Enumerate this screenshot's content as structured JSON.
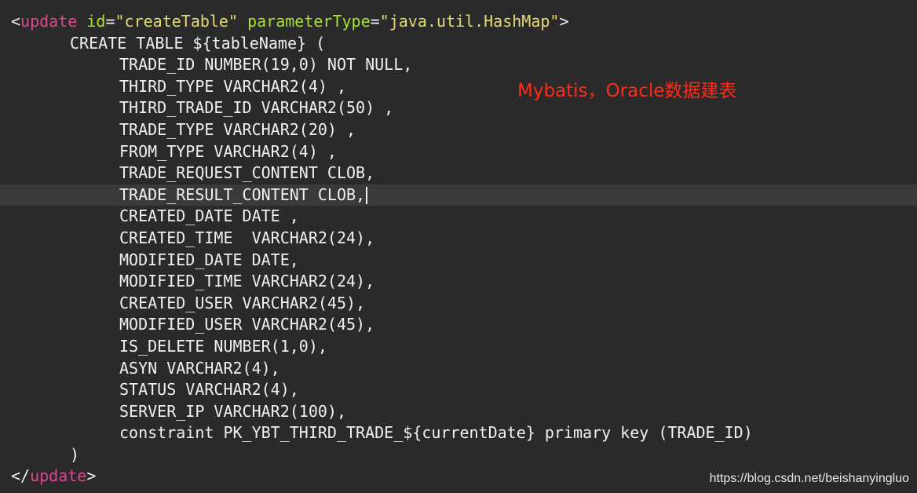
{
  "code": {
    "open_tag": {
      "lt": "<",
      "tag": "update",
      "attr1_name": "id",
      "attr1_value": "\"createTable\"",
      "attr2_name": "parameterType",
      "attr2_value": "\"java.util.HashMap\"",
      "gt": ">"
    },
    "create_line": "CREATE TABLE ${tableName} (",
    "columns": [
      "TRADE_ID NUMBER(19,0) NOT NULL,",
      "THIRD_TYPE VARCHAR2(4) ,",
      "THIRD_TRADE_ID VARCHAR2(50) ,",
      "TRADE_TYPE VARCHAR2(20) ,",
      "FROM_TYPE VARCHAR2(4) ,",
      "TRADE_REQUEST_CONTENT CLOB,",
      "TRADE_RESULT_CONTENT CLOB,",
      "CREATED_DATE DATE ,",
      "CREATED_TIME  VARCHAR2(24),",
      "MODIFIED_DATE DATE,",
      "MODIFIED_TIME VARCHAR2(24),",
      "CREATED_USER VARCHAR2(45),",
      "MODIFIED_USER VARCHAR2(45),",
      "IS_DELETE NUMBER(1,0),",
      "ASYN VARCHAR2(4),",
      "STATUS VARCHAR2(4),",
      "SERVER_IP VARCHAR2(100),",
      "constraint PK_YBT_THIRD_TRADE_${currentDate} primary key (TRADE_ID)"
    ],
    "close_paren": ")",
    "close_tag": {
      "lt": "</",
      "tag": "update",
      "gt": ">"
    }
  },
  "annotation": "Mybatis，Oracle数据建表",
  "watermark": "https://blog.csdn.net/beishanyingluo",
  "colors": {
    "background": "#2a2a2a",
    "tag": "#e0458f",
    "attribute": "#a6e22e",
    "string": "#e6db74",
    "annotation": "#ff2a1a"
  }
}
